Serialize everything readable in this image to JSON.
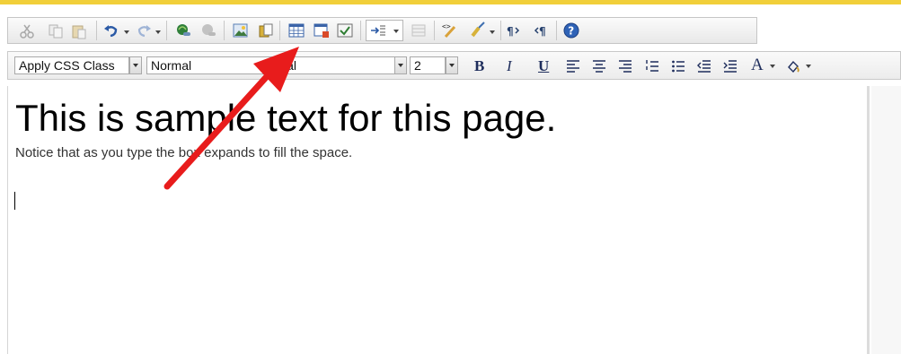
{
  "toolbar": {
    "row1_buttons": [
      {
        "name": "cut",
        "icon": "scissors-icon"
      },
      {
        "name": "copy",
        "icon": "copy-icon"
      },
      {
        "name": "paste",
        "icon": "paste-icon"
      },
      {
        "name": "undo",
        "icon": "undo-icon"
      },
      {
        "name": "redo",
        "icon": "redo-icon"
      },
      {
        "name": "insert-hyperlink",
        "icon": "link-icon"
      },
      {
        "name": "remove-hyperlink",
        "icon": "unlink-icon"
      },
      {
        "name": "insert-image",
        "icon": "image-icon"
      },
      {
        "name": "insert-document",
        "icon": "document-icon"
      },
      {
        "name": "insert-table",
        "icon": "table-icon"
      },
      {
        "name": "table-properties",
        "icon": "table-properties-icon"
      },
      {
        "name": "form-element",
        "icon": "checkbox-form-icon"
      },
      {
        "name": "paragraph-direction",
        "icon": "indent-arrow-icon"
      },
      {
        "name": "insert-special",
        "icon": "symbol-icon"
      },
      {
        "name": "html-source",
        "icon": "source-code-icon"
      },
      {
        "name": "format-stripper",
        "icon": "brush-icon"
      },
      {
        "name": "ltr",
        "icon": "paragraph-ltr-icon"
      },
      {
        "name": "rtl",
        "icon": "paragraph-rtl-icon"
      },
      {
        "name": "help",
        "icon": "help-icon"
      }
    ],
    "css_class_select": "Apply CSS Class",
    "paragraph_style_select": "Normal",
    "font_name_select": "Arial",
    "font_size_select": "2",
    "bold_label": "B",
    "italic_label": "I",
    "underline_label": "U",
    "font_color_label": "A",
    "accent_color": "#f1cf3a",
    "annotation_arrow_color": "#e81c1c"
  },
  "editor": {
    "headline": "This is sample text for this page.",
    "body_text": "Notice that as you type the box expands to fill the space."
  }
}
